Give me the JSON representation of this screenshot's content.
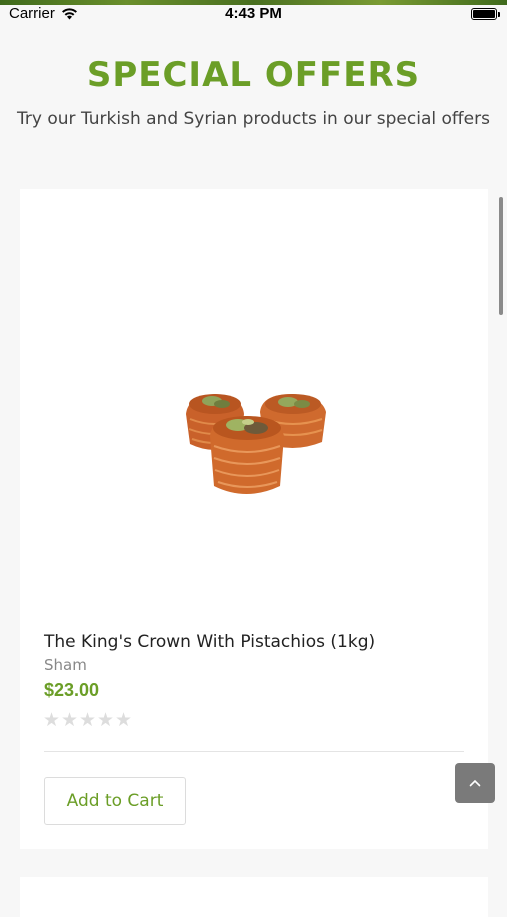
{
  "status_bar": {
    "carrier": "Carrier",
    "time": "4:43 PM"
  },
  "header": {
    "title": "SPECIAL OFFERS",
    "subtitle": "Try our Turkish and Syrian products in our special offers"
  },
  "product": {
    "name": "The King's Crown With Pistachios (1kg)",
    "brand": "Sham",
    "price": "$23.00",
    "rating": 0,
    "rating_max": 5,
    "add_to_cart_label": "Add to Cart"
  },
  "colors": {
    "accent": "#6b9e27",
    "scroll_button": "#7a7a7a"
  },
  "icons": {
    "wifi": "wifi-icon",
    "battery": "battery-icon",
    "scroll_top": "chevron-up-icon",
    "star": "star-icon"
  }
}
